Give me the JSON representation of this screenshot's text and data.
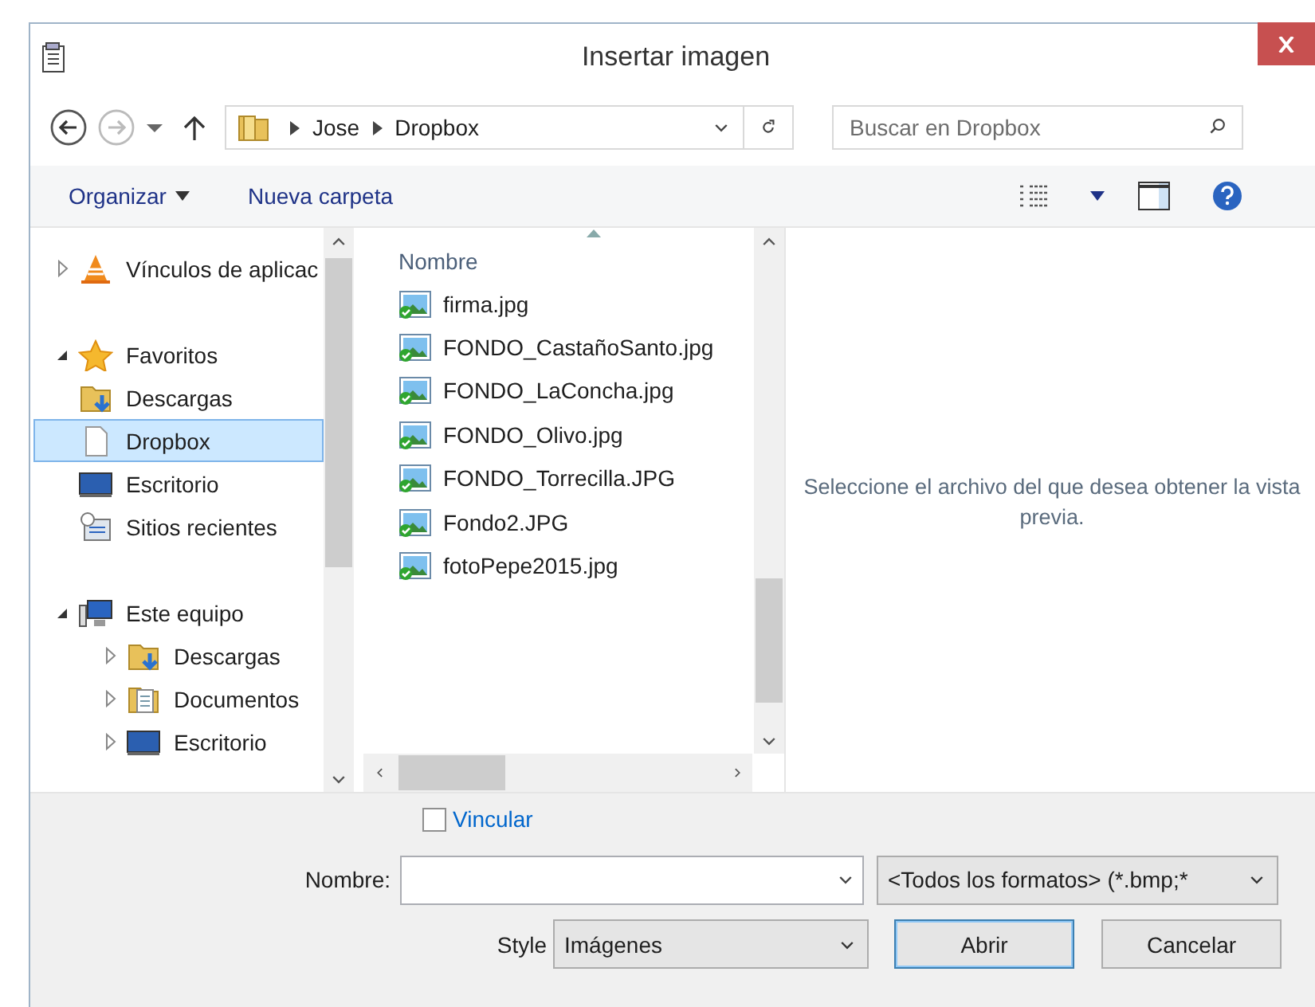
{
  "window": {
    "title": "Insertar imagen"
  },
  "address_bar": {
    "path": [
      "Jose",
      "Dropbox"
    ]
  },
  "search": {
    "placeholder": "Buscar en Dropbox"
  },
  "toolbar": {
    "organize": "Organizar",
    "new_folder": "Nueva carpeta"
  },
  "navigation": {
    "items": [
      {
        "label": "Vínculos de aplicac",
        "kind": "app-links",
        "expanded": false,
        "selected": false
      },
      {
        "label": "Favoritos",
        "kind": "favorites",
        "expanded": true,
        "selected": false,
        "children": [
          {
            "label": "Descargas",
            "kind": "downloads",
            "selected": false
          },
          {
            "label": "Dropbox",
            "kind": "document",
            "selected": true
          },
          {
            "label": "Escritorio",
            "kind": "desktop",
            "selected": false
          },
          {
            "label": "Sitios recientes",
            "kind": "recent",
            "selected": false
          }
        ]
      },
      {
        "label": "Este equipo",
        "kind": "computer",
        "expanded": true,
        "selected": false,
        "children": [
          {
            "label": "Descargas",
            "kind": "downloads",
            "expanded": false,
            "selected": false
          },
          {
            "label": "Documentos",
            "kind": "documents",
            "expanded": false,
            "selected": false
          },
          {
            "label": "Escritorio",
            "kind": "desktop",
            "expanded": false,
            "selected": false
          }
        ]
      }
    ]
  },
  "file_list": {
    "columns": [
      "Nombre"
    ],
    "rows": [
      {
        "name": "firma.jpg"
      },
      {
        "name": "FONDO_CastañoSanto.jpg"
      },
      {
        "name": "FONDO_LaConcha.jpg"
      },
      {
        "name": "FONDO_Olivo.jpg"
      },
      {
        "name": "FONDO_Torrecilla.JPG"
      },
      {
        "name": "Fondo2.JPG"
      },
      {
        "name": "fotoPepe2015.jpg"
      }
    ]
  },
  "preview": {
    "message": "Seleccione el archivo del que desea obtener la vista previa."
  },
  "link_option": {
    "label": "Vincular",
    "checked": false
  },
  "file_name": {
    "label": "Nombre:"
  },
  "file_type": {
    "value": "<Todos los formatos>  (*.bmp;*"
  },
  "style": {
    "label": "Style",
    "value": "Imágenes"
  },
  "buttons": [
    {
      "label": "Abrir",
      "default": true
    },
    {
      "label": "Cancelar",
      "default": false
    }
  ]
}
